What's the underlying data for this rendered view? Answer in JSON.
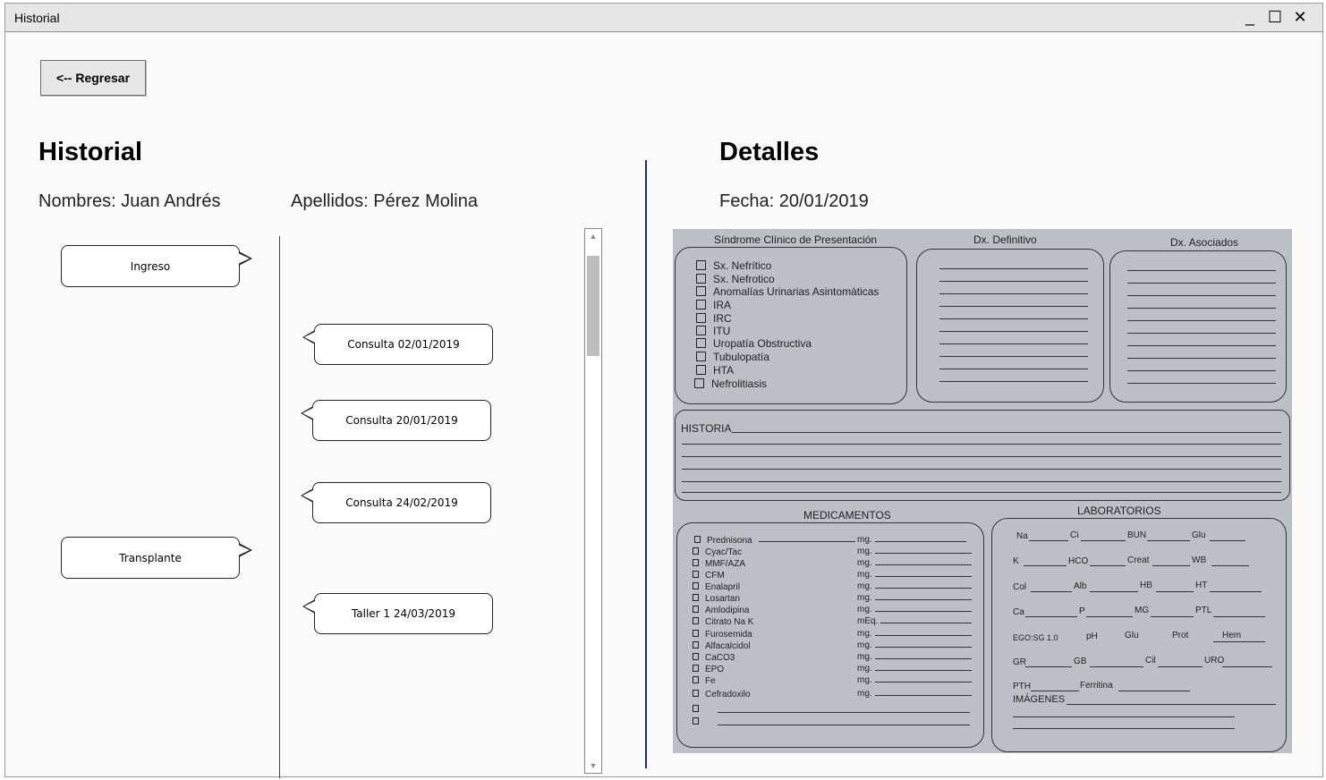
{
  "window": {
    "title": "Historial",
    "controls": {
      "minimize": "_",
      "maximize": "☐",
      "close": "✕"
    }
  },
  "back_button": "<-- Regresar",
  "left": {
    "heading": "Historial",
    "names": "Nombres: Juan Andrés",
    "surnames": "Apellidos: Pérez Molina",
    "timeline_left": [
      "Ingreso",
      "Transplante"
    ],
    "timeline_right": [
      "Consulta 02/01/2019",
      "Consulta 20/01/2019",
      "Consulta 24/02/2019",
      "Taller 1 24/03/2019"
    ]
  },
  "right": {
    "heading": "Detalles",
    "date": "Fecha: 20/01/2019"
  },
  "form": {
    "sindrome_title": "Síndrome Clínico de Presentación",
    "dx_definitivo": "Dx. Definitivo",
    "dx_asociados": "Dx. Asociados",
    "syndromes": [
      "Sx. Nefrítico",
      "Sx. Nefrotico",
      "Anomalías Urinarias Asintomáticas",
      "IRA",
      "IRC",
      "ITU",
      "Uropatía Obstructiva",
      "Tubulopatía",
      "HTA",
      "Nefrolitiasis"
    ],
    "historia": "HISTORIA",
    "medicamentos_title": "MEDICAMENTOS",
    "laboratorios_title": "LABORATORIOS",
    "meds": [
      {
        "name": "Prednisona",
        "unit": "mg."
      },
      {
        "name": "Cyac/Tac",
        "unit": "mg."
      },
      {
        "name": "MMF/AZA",
        "unit": "mg."
      },
      {
        "name": "CFM",
        "unit": "mg."
      },
      {
        "name": "Enalapril",
        "unit": "mg."
      },
      {
        "name": "Losartan",
        "unit": "mg."
      },
      {
        "name": "Amlodipina",
        "unit": "mg."
      },
      {
        "name": "Citrato Na K",
        "unit": "mEq."
      },
      {
        "name": "Furosemida",
        "unit": "mg."
      },
      {
        "name": "Alfacalcidol",
        "unit": "mg."
      },
      {
        "name": "CaCO3",
        "unit": "mg."
      },
      {
        "name": "EPO",
        "unit": "mg."
      },
      {
        "name": "Fe",
        "unit": "mg."
      },
      {
        "name": "Cefradoxilo",
        "unit": "mg."
      }
    ],
    "labs": [
      [
        "Na",
        "Ci",
        "BUN",
        "Glu"
      ],
      [
        "K",
        "HCO",
        "Creat",
        "WB"
      ],
      [
        "Col",
        "Alb",
        "HB",
        "HT"
      ],
      [
        "Ca",
        "P",
        "MG",
        "PTL"
      ],
      [
        "EGO:SG 1.0",
        "pH",
        "Glu",
        "Prot",
        "Hem"
      ],
      [
        "GR",
        "GB",
        "Cil",
        "URO"
      ],
      [
        "PTH",
        "Ferritina"
      ]
    ],
    "imagenes": "IMÁGENES"
  }
}
